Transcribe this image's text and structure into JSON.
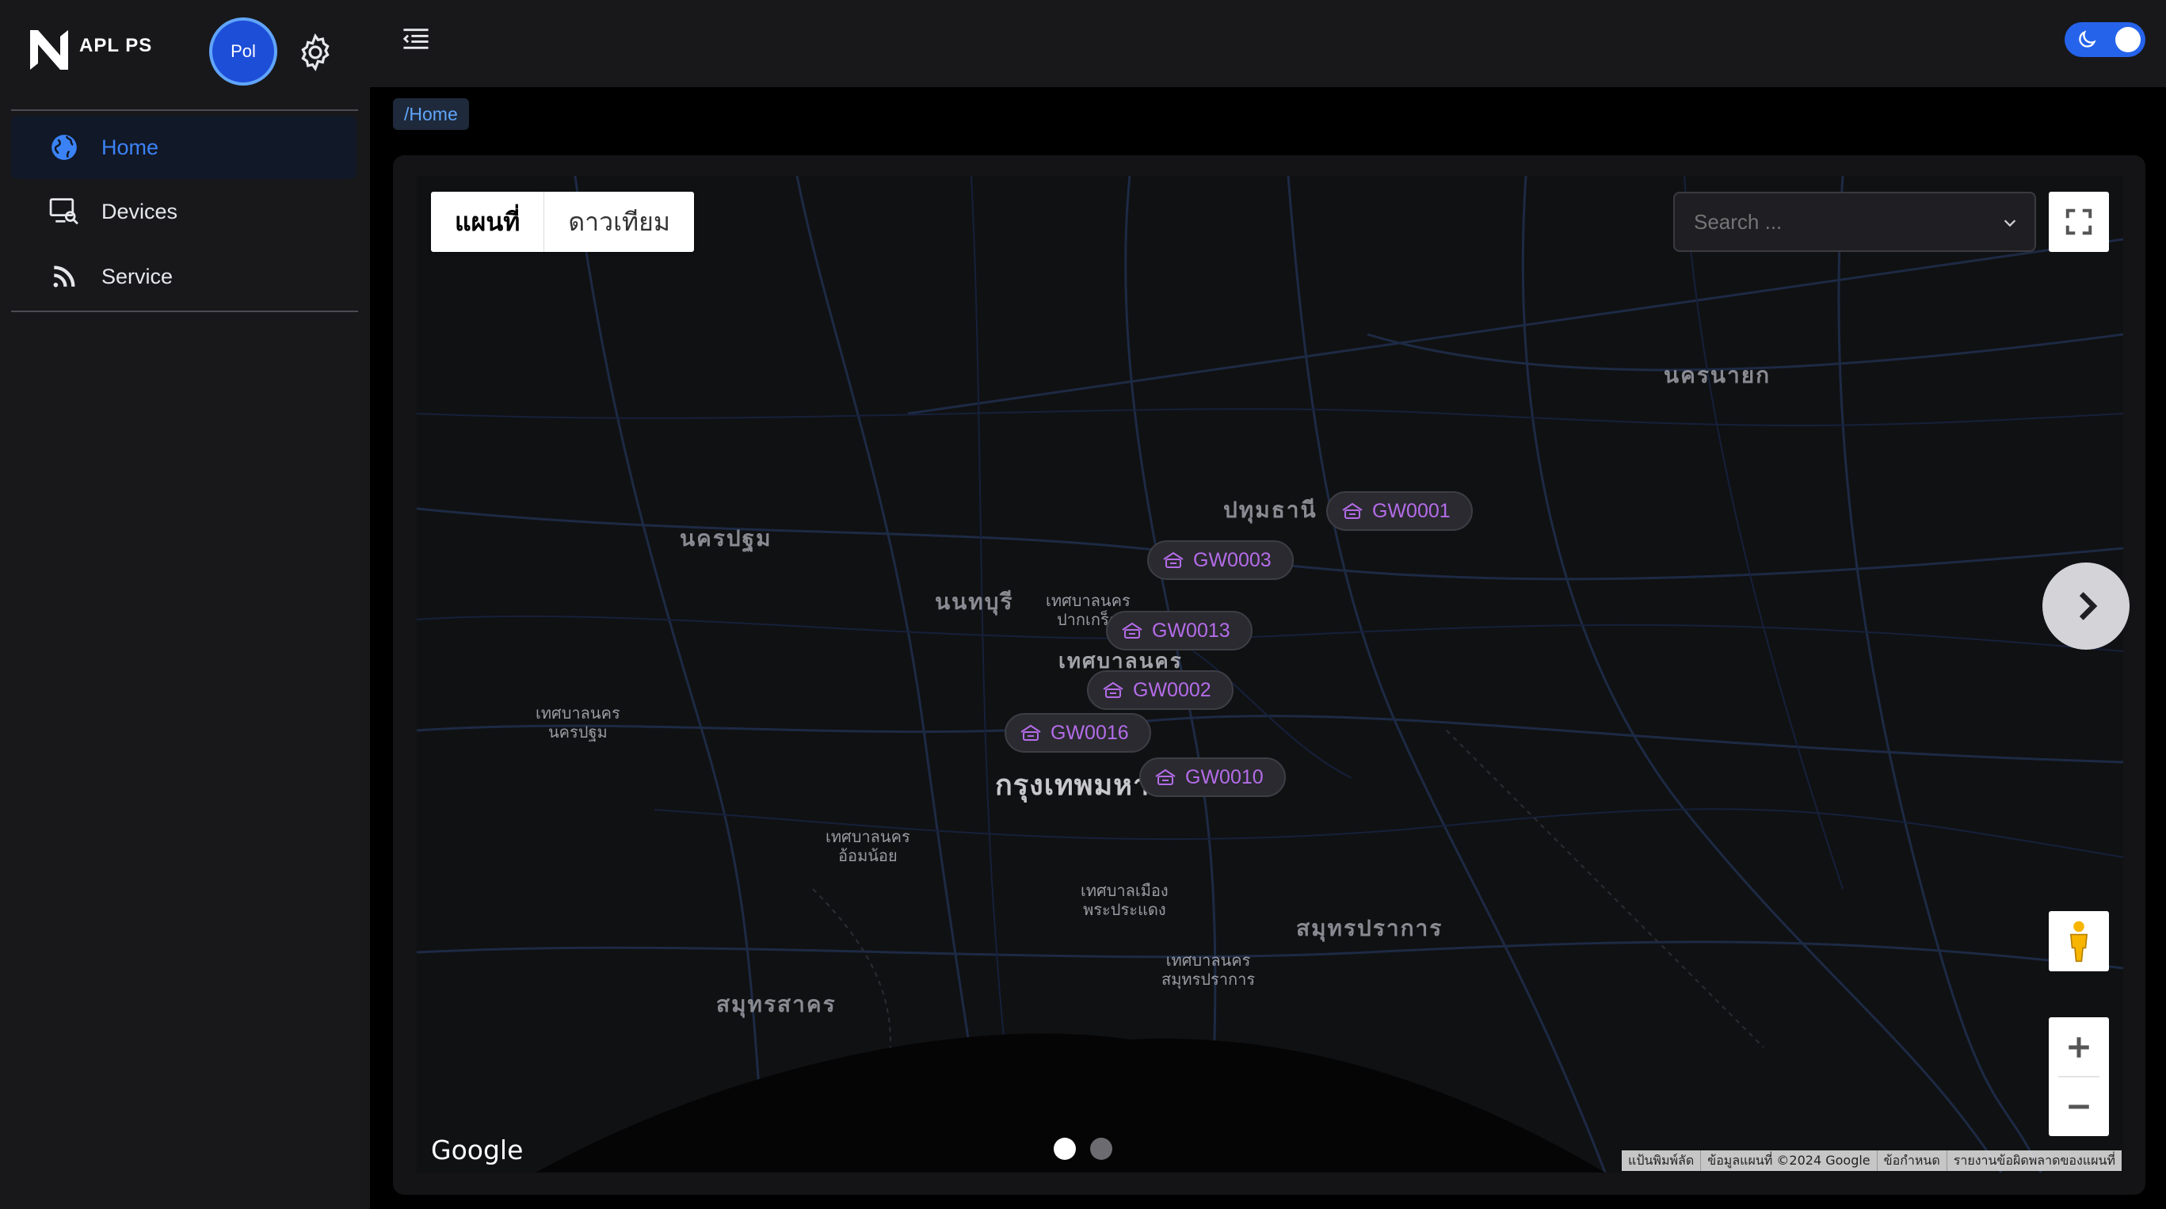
{
  "app": {
    "logo_text": "APL PS",
    "avatar_initials": "Pol"
  },
  "sidebar": {
    "items": [
      {
        "label": "Home",
        "icon": "globe-icon",
        "active": true
      },
      {
        "label": "Devices",
        "icon": "device-search-icon",
        "active": false
      },
      {
        "label": "Service",
        "icon": "rss-icon",
        "active": false
      }
    ]
  },
  "breadcrumb": "/Home",
  "map": {
    "type_buttons": [
      "แผนที่",
      "ดาวเทียม"
    ],
    "search_placeholder": "Search ...",
    "places": {
      "nakhon_nayok": "นครนายก",
      "pathum_thani": "ปทุมธานี",
      "nakhon_pathom": "นครปฐม",
      "nonthaburi": "นนทบุรี",
      "pak_kret": "เทศบาลนคร\nปากเกร็ด",
      "nonthaburi_city": "เทศบาลนคร",
      "nakhon_pathom_city": "เทศบาลนคร\nนครปฐม",
      "bangkok": "กรุงเทพมหานคร",
      "om_noi": "เทศบาลนคร\nอ้อมน้อย",
      "phra_pradaeng": "เทศบาลเมือง\nพระประแดง",
      "samut_prakan": "สมุทรปราการ",
      "samut_prakan_city": "เทศบาลนคร\nสมุทรปราการ",
      "samut_sakhon": "สมุทรสาคร"
    },
    "gateways": [
      "GW0001",
      "GW0003",
      "GW0013",
      "GW0002",
      "GW0016",
      "GW0010"
    ],
    "google_label": "Google",
    "attribution": [
      "แป้นพิมพ์ลัด",
      "ข้อมูลแผนที่ ©2024 Google",
      "ข้อกำหนด",
      "รายงานข้อผิดพลาดของแผนที่"
    ],
    "carousel_active": 0
  },
  "colors": {
    "accent": "#2563eb",
    "gateway": "#b46ce8"
  }
}
